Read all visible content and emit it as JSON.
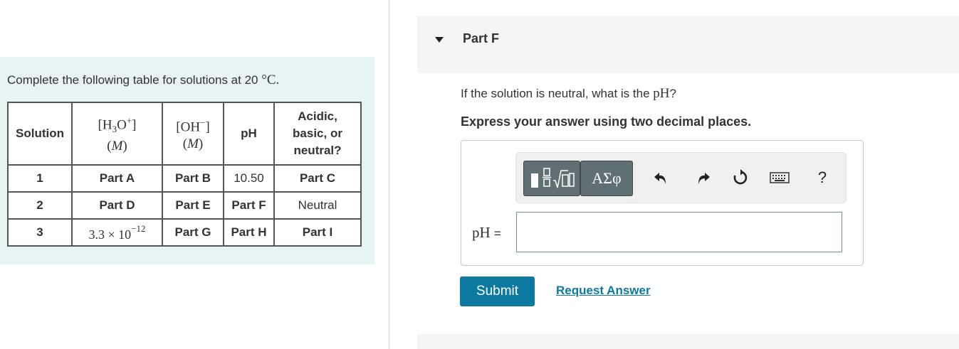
{
  "problem": {
    "intro_prefix": "Complete the following table for solutions at 20",
    "intro_temp": "°C.",
    "table": {
      "headers": {
        "solution": "Solution",
        "h3o_top": "[H3O+]",
        "h3o_unit": "(M)",
        "oh_top": "[OH−]",
        "oh_unit": "(M)",
        "ph": "pH",
        "nature_line1": "Acidic,",
        "nature_line2": "basic, or",
        "nature_line3": "neutral?"
      },
      "rows": [
        {
          "solution": "1",
          "h3o": "Part A",
          "oh": "Part B",
          "ph": "10.50",
          "nature": "Part C"
        },
        {
          "solution": "2",
          "h3o": "Part D",
          "oh": "Part E",
          "ph": "Part F",
          "nature": "Neutral"
        },
        {
          "solution": "3",
          "h3o_mantissa": "3.3 × 10",
          "h3o_exp": "−12",
          "oh": "Part G",
          "ph": "Part H",
          "nature": "Part I"
        }
      ]
    }
  },
  "part": {
    "title": "Part F",
    "question_prefix": "If the solution is neutral, what is the",
    "question_var": "pH",
    "question_suffix": "?",
    "instruction": "Express your answer using two decimal places."
  },
  "toolbar": {
    "greek_label": "ΑΣφ",
    "help_label": "?",
    "icons": [
      "templates-icon",
      "undo-icon",
      "redo-icon",
      "reset-icon",
      "keyboard-icon",
      "help-icon"
    ]
  },
  "answer": {
    "label_var": "pH",
    "label_eq": "=",
    "value": ""
  },
  "actions": {
    "submit_label": "Submit",
    "request_answer_label": "Request Answer"
  },
  "colors": {
    "left_panel_bg": "#e6f4f4",
    "accent": "#0c7aa0",
    "toolbar_button": "#5f6f73"
  }
}
